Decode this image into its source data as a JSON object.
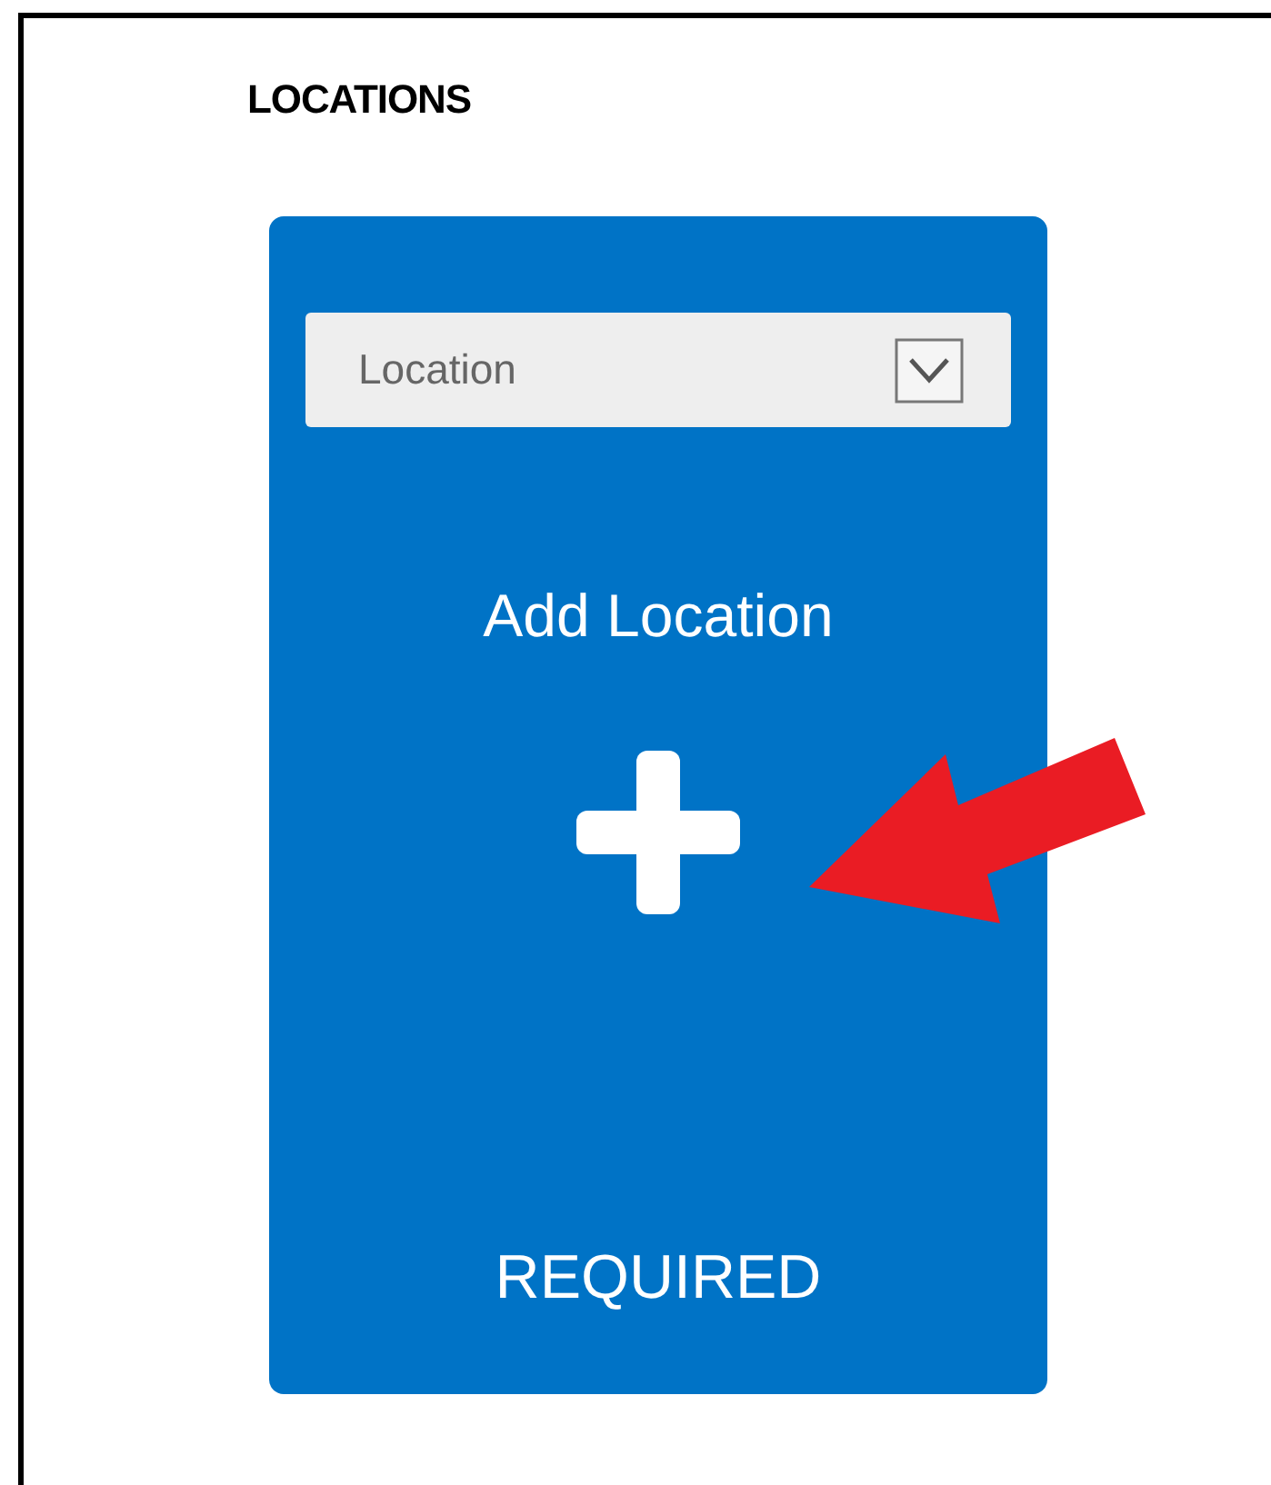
{
  "section": {
    "title": "LOCATIONS"
  },
  "card": {
    "dropdown": {
      "value": "Location"
    },
    "add_label": "Add Location",
    "status": "REQUIRED"
  }
}
